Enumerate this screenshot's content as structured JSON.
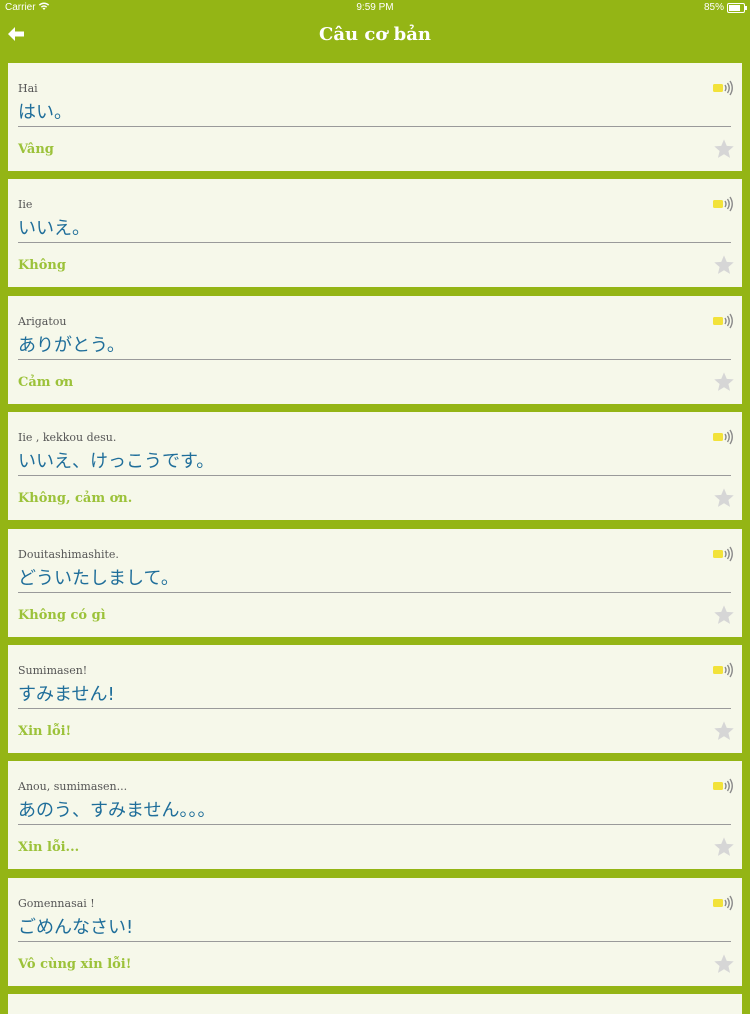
{
  "status_bar": {
    "carrier": "Carrier",
    "time": "9:59 PM",
    "battery": "85%"
  },
  "header": {
    "title": "Câu cơ bản",
    "back_icon": "arrow-left-icon"
  },
  "colors": {
    "background": "#94b515",
    "card": "#f6f8ea",
    "japanese_text": "#1f6e9a",
    "meaning_text": "#9cc23a",
    "star": "#d6d6d6",
    "speaker": "#f2e23a"
  },
  "phrases": [
    {
      "romaji": "Hai",
      "japanese": "はい。",
      "meaning": "Vâng"
    },
    {
      "romaji": "Iie",
      "japanese": "いいえ。",
      "meaning": "Không"
    },
    {
      "romaji": "Arigatou",
      "japanese": "ありがとう。",
      "meaning": "Cảm ơn"
    },
    {
      "romaji": "Iie , kekkou desu.",
      "japanese": "いいえ、けっこうです。",
      "meaning": "Không, cảm ơn."
    },
    {
      "romaji": "Douitashimashite.",
      "japanese": "どういたしまして。",
      "meaning": "Không có gì"
    },
    {
      "romaji": "Sumimasen!",
      "japanese": "すみません!",
      "meaning": "Xin lỗi!"
    },
    {
      "romaji": "Anou, sumimasen...",
      "japanese": "あのう、すみません。。。",
      "meaning": "Xin lỗi..."
    },
    {
      "romaji": "Gomennasai !",
      "japanese": "ごめんなさい!",
      "meaning": "Vô cùng xin lỗi!"
    }
  ]
}
